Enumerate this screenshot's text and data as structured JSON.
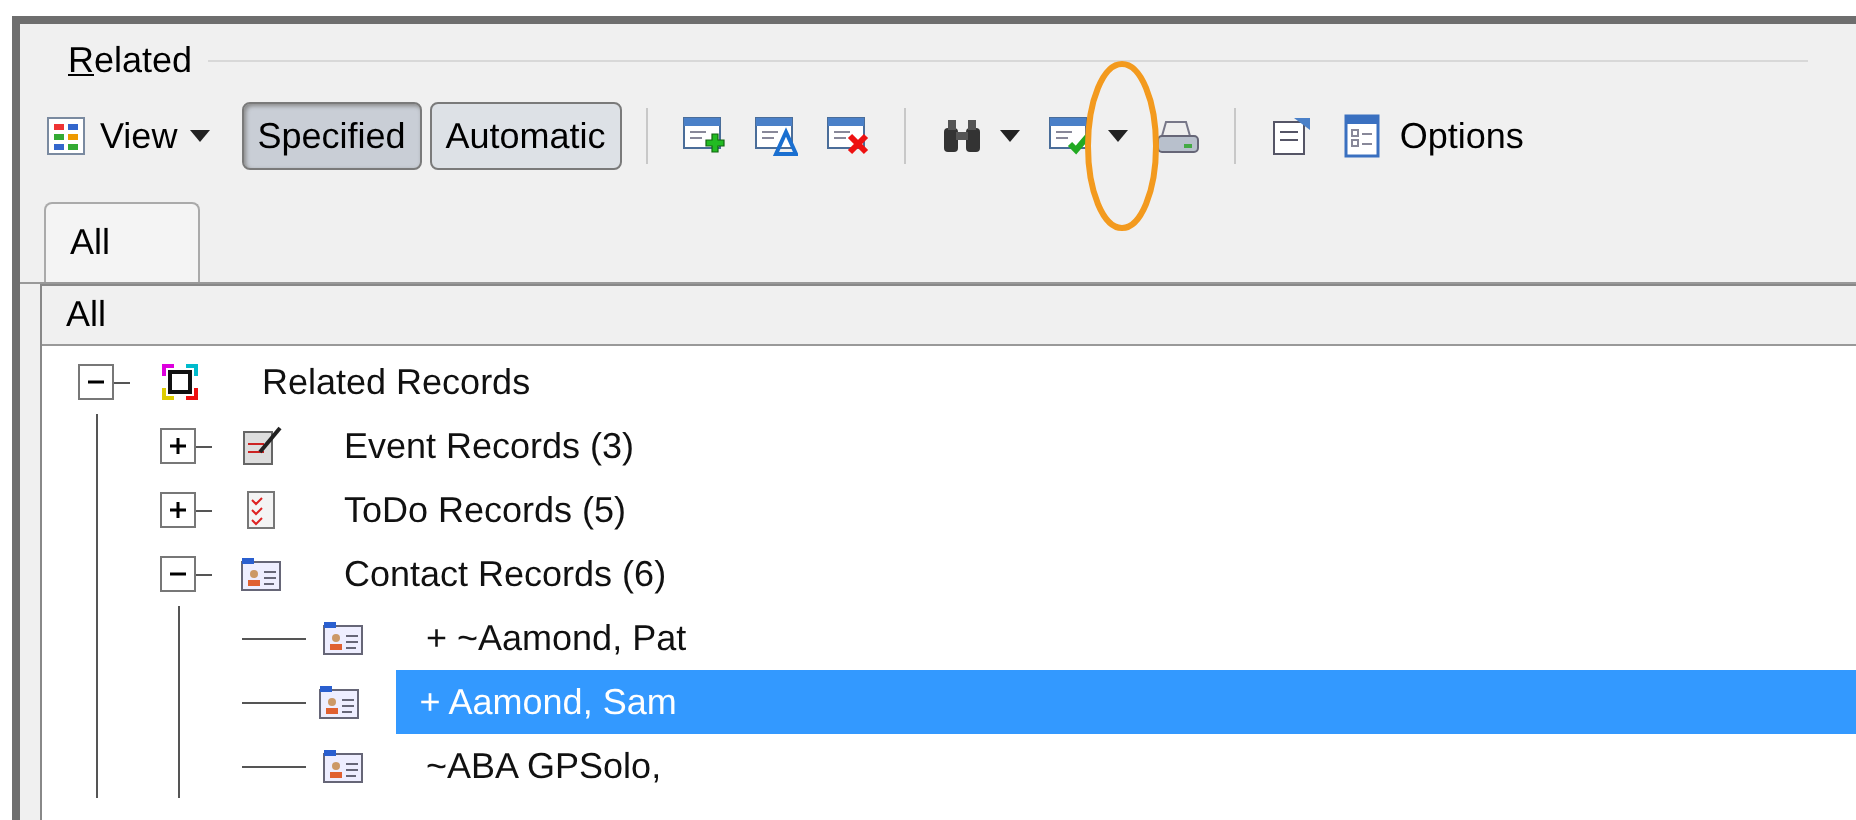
{
  "group": {
    "label": "Related"
  },
  "toolbar": [
    {
      "kind": "dropdown",
      "label": "View"
    },
    {
      "kind": "toggle",
      "label": "Specified",
      "selected": true
    },
    {
      "kind": "toggle",
      "label": "Automatic",
      "selected": false
    },
    {
      "kind": "separator"
    },
    {
      "kind": "icon"
    },
    {
      "kind": "icon"
    },
    {
      "kind": "icon"
    },
    {
      "kind": "separator"
    },
    {
      "kind": "icon-dropdown"
    },
    {
      "kind": "icon-dropdown",
      "highlighted": true
    },
    {
      "kind": "icon"
    },
    {
      "kind": "separator"
    },
    {
      "kind": "icon"
    },
    {
      "kind": "button",
      "label": "Options"
    }
  ],
  "tabs": [
    {
      "label": "All",
      "selected": true
    }
  ],
  "list": {
    "header": "All",
    "tree": [
      {
        "label": "Related Records",
        "kind": "related",
        "expanded": true,
        "selected": false,
        "children": [
          {
            "label": "Event Records (3)",
            "kind": "event",
            "expanded": false,
            "selected": false
          },
          {
            "label": "ToDo Records (5)",
            "kind": "todo",
            "expanded": false,
            "selected": false
          },
          {
            "label": "Contact Records (6)",
            "kind": "contact",
            "expanded": true,
            "selected": false,
            "children": [
              {
                "label": "+ ~Aamond, Pat",
                "kind": "contact",
                "selected": false
              },
              {
                "label": "+ Aamond, Sam",
                "kind": "contact",
                "selected": true
              },
              {
                "label": "~ABA GPSolo,",
                "kind": "contact",
                "selected": false
              }
            ]
          }
        ]
      }
    ]
  }
}
